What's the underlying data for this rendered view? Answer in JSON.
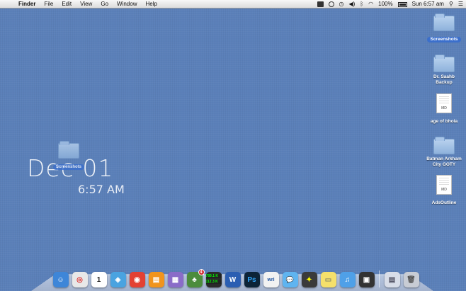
{
  "menubar": {
    "apple_glyph": "",
    "app_name": "Finder",
    "menus": [
      "File",
      "Edit",
      "View",
      "Go",
      "Window",
      "Help"
    ],
    "battery": "100%",
    "clock": "Sun 6:57 am"
  },
  "desktop": {
    "icons": [
      {
        "label": "Screenshots",
        "kind": "folder",
        "selected": true
      },
      {
        "label": "Dr. Saahb Backup",
        "kind": "folder",
        "selected": false
      },
      {
        "label": "age of bhola",
        "kind": "doc",
        "doc_text": "MD",
        "selected": false
      },
      {
        "label": "Batman Arkham City GOTY",
        "kind": "folder",
        "selected": false
      },
      {
        "label": "AdsOutline",
        "kind": "doc",
        "doc_text": "MD",
        "selected": false
      }
    ],
    "drag_folder_label": "Screenshots"
  },
  "clock_widget": {
    "date": "Dec 01",
    "time": "6:57 AM"
  },
  "dock": {
    "items": [
      {
        "name": "finder",
        "color": "#3e86d8",
        "glyph": "☺"
      },
      {
        "name": "app-red-circle",
        "color": "#e8e8e8",
        "glyph": "◎"
      },
      {
        "name": "calendar",
        "color": "#ffffff",
        "glyph": "1"
      },
      {
        "name": "safari",
        "color": "#4aa3e0",
        "glyph": "◈"
      },
      {
        "name": "chrome",
        "color": "#e34133",
        "glyph": "◉"
      },
      {
        "name": "ibooks",
        "color": "#f0941d",
        "glyph": "▤"
      },
      {
        "name": "preview",
        "color": "#8a6cc8",
        "glyph": "▦"
      },
      {
        "name": "tree-app",
        "color": "#4c8c3c",
        "glyph": "♣",
        "badge": "4"
      },
      {
        "name": "network-monitor",
        "color": "#2a2a2a",
        "stat_top": "789.1 K",
        "stat_bottom": "112.3 K"
      },
      {
        "name": "word",
        "color": "#2b5eb2",
        "glyph": "W"
      },
      {
        "name": "photoshop",
        "color": "#0c2438",
        "glyph": "Ps"
      },
      {
        "name": "writer",
        "color": "#f2f2f2",
        "glyph": "wri"
      },
      {
        "name": "messages",
        "color": "#5fb4f0",
        "glyph": "💬"
      },
      {
        "name": "gaming",
        "color": "#3a3a3a",
        "glyph": "✦"
      },
      {
        "name": "stickies",
        "color": "#f5e06b",
        "glyph": "▭"
      },
      {
        "name": "itunes",
        "color": "#4fa0e8",
        "glyph": "♫"
      },
      {
        "name": "mission-control",
        "color": "#333333",
        "glyph": "▣"
      }
    ],
    "right_items": [
      {
        "name": "downloads-stack",
        "color": "#d8dde8",
        "glyph": "▤"
      },
      {
        "name": "trash",
        "color": "#c8ccd4",
        "glyph": "🗑"
      }
    ]
  }
}
